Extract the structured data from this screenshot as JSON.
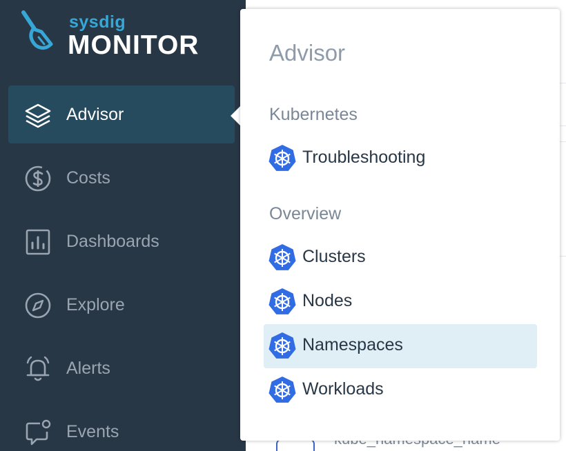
{
  "brand": {
    "sub": "sysdig",
    "name": "MONITOR"
  },
  "sidebar": {
    "items": [
      {
        "label": "Advisor",
        "icon": "layers-icon",
        "active": true
      },
      {
        "label": "Costs",
        "icon": "dollar-icon",
        "active": false
      },
      {
        "label": "Dashboards",
        "icon": "bar-chart-icon",
        "active": false
      },
      {
        "label": "Explore",
        "icon": "compass-icon",
        "active": false
      },
      {
        "label": "Alerts",
        "icon": "bell-icon",
        "active": false
      },
      {
        "label": "Events",
        "icon": "chat-bubble-icon",
        "active": false
      }
    ]
  },
  "popup": {
    "title": "Advisor",
    "sections": [
      {
        "title": "Kubernetes",
        "items": [
          {
            "label": "Troubleshooting"
          }
        ]
      },
      {
        "title": "Overview",
        "items": [
          {
            "label": "Clusters"
          },
          {
            "label": "Nodes"
          },
          {
            "label": "Namespaces",
            "selected": true
          },
          {
            "label": "Workloads"
          }
        ]
      }
    ]
  },
  "background": {
    "partial_text": "kube_namespace_name"
  },
  "colors": {
    "sidebar": "#283746",
    "active": "#264a5e",
    "accent": "#36a7d6",
    "k8s": "#326ce5",
    "selected": "#dfeff5"
  }
}
